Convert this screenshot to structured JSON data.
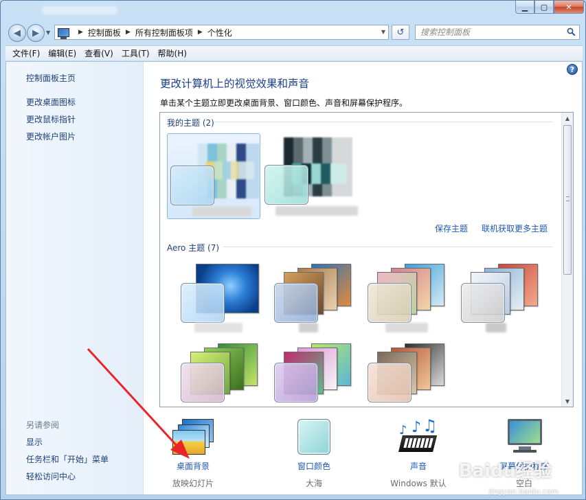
{
  "colors": {
    "link": "#1f58b3",
    "title": "#1a3f8a",
    "chrome": "#c9e1f5",
    "annotation_arrow": "#e8262a"
  },
  "window": {
    "caption_buttons": {
      "minimize": "▁",
      "maximize": "▢",
      "close": "✕"
    }
  },
  "nav": {
    "back_icon": "back-arrow-icon",
    "forward_icon": "forward-arrow-icon",
    "breadcrumb": [
      "控制面板",
      "所有控制面板项",
      "个性化"
    ],
    "refresh_glyph": "↺",
    "search_placeholder": "搜索控制面板"
  },
  "menubar": [
    "文件(F)",
    "编辑(E)",
    "查看(V)",
    "工具(T)",
    "帮助(H)"
  ],
  "sidebar": {
    "links": [
      "控制面板主页",
      "更改桌面图标",
      "更改鼠标指针",
      "更改帐户图片"
    ],
    "see_also_caption": "另请参阅",
    "see_also_links": [
      "显示",
      "任务栏和「开始」菜单",
      "轻松访问中心"
    ]
  },
  "main": {
    "title": "更改计算机上的视觉效果和声音",
    "description": "单击某个主题立即更改桌面背景、窗口颜色、声音和屏幕保护程序。",
    "help_glyph": "?"
  },
  "themes": {
    "my_themes_heading": "我的主题 (2)",
    "aero_heading": "Aero 主题 (7)",
    "save_theme_link": "保存主题",
    "get_more_link": "联机获取更多主题"
  },
  "tools": [
    {
      "label": "桌面背景",
      "sub": "放映幻灯片",
      "icon": "desktop-background-icon"
    },
    {
      "label": "窗口颜色",
      "sub": "大海",
      "icon": "window-color-icon"
    },
    {
      "label": "声音",
      "sub": "Windows 默认",
      "icon": "sound-notes-icon"
    },
    {
      "label": "屏幕保护程序",
      "sub": "空白",
      "icon": "screensaver-monitor-icon"
    }
  ],
  "watermark": {
    "logo": "Baidu经验",
    "url": "jingyan.baidu.com"
  }
}
